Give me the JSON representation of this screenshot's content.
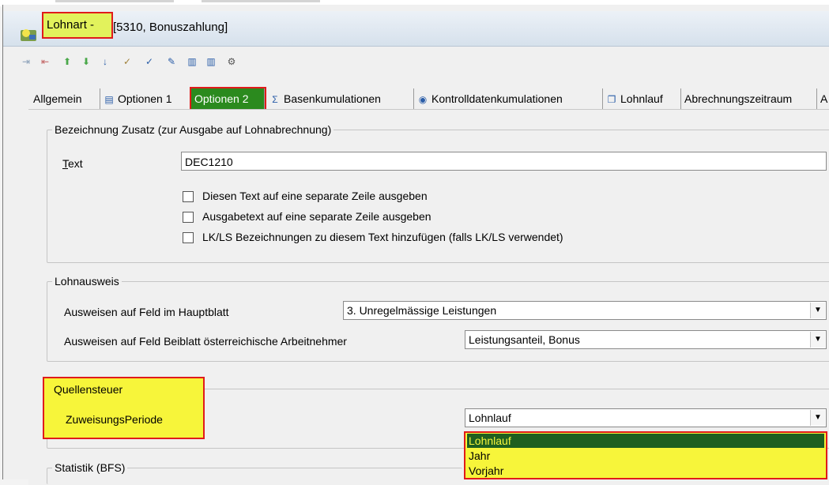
{
  "window": {
    "title_prefix": "Lohnart -",
    "title_rest": "[5310, Bonuszahlung]"
  },
  "toolbar": {
    "icons": [
      "indent-icon",
      "delete-row-icon",
      "move-up-icon",
      "move-down-icon",
      "sort-az-icon",
      "spellcheck-icon",
      "spellcheck2-icon",
      "edit-icon",
      "columns-icon",
      "columns2-icon",
      "settings-icon"
    ]
  },
  "tabs": {
    "allgemein": "Allgemein",
    "optionen1": "Optionen 1",
    "optionen2": "Optionen 2",
    "basenkumulationen": "Basenkumulationen",
    "kontrolldaten": "Kontrolldatenkumulationen",
    "lohnlauf": "Lohnlauf",
    "abrechnungszeitraum": "Abrechnungszeitraum",
    "overflow": "A"
  },
  "bezeichnung": {
    "legend": "Bezeichnung Zusatz (zur Ausgabe auf Lohnabrechnung)",
    "text_label": "Text",
    "text_value": "DEC1210",
    "check1": "Diesen Text auf eine separate Zeile ausgeben",
    "check2": "Ausgabetext auf eine separate Zeile ausgeben",
    "check3": "LK/LS Bezeichnungen zu diesem Text hinzufügen (falls LK/LS verwendet)"
  },
  "lohnausweis": {
    "legend": "Lohnausweis",
    "field1_label": "Ausweisen auf Feld im Hauptblatt",
    "field1_value": "3. Unregelmässige Leistungen",
    "field2_label": "Ausweisen auf Feld Beiblatt österreichische Arbeitnehmer",
    "field2_value": "Leistungsanteil, Bonus"
  },
  "quellensteuer": {
    "legend": "Quellensteuer",
    "field_label": "ZuweisungsPeriode",
    "field_value": "Lohnlauf",
    "options": [
      "Lohnlauf",
      "Jahr",
      "Vorjahr"
    ]
  },
  "statistik": {
    "legend": "Statistik (BFS)"
  }
}
